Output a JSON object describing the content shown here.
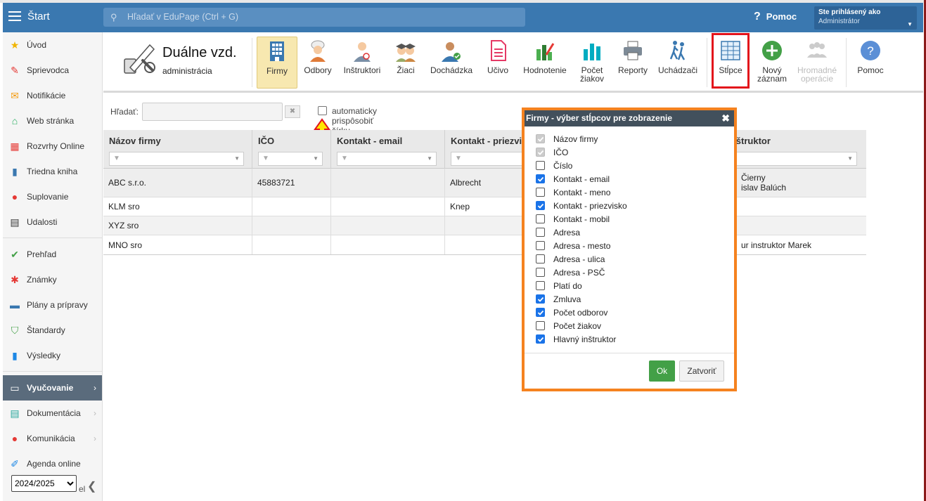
{
  "topbar": {
    "start_label": "Štart",
    "search_placeholder": "Hľadať v EduPage (Ctrl + G)",
    "help_label": "Pomoc",
    "user_line1": "Ste prihlásený ako",
    "user_line2": "Administrátor"
  },
  "sidebar": {
    "items": [
      {
        "label": "Úvod",
        "icon": "star-icon",
        "color": "#f0b400"
      },
      {
        "label": "Sprievodca",
        "icon": "wand-icon",
        "color": "#e53935"
      },
      {
        "label": "Notifikácie",
        "icon": "envelope-icon",
        "color": "#f39c12"
      },
      {
        "label": "Web stránka",
        "icon": "home-icon",
        "color": "#27ae60"
      },
      {
        "label": "Rozvrhy Online",
        "icon": "grid-icon",
        "color": "#e53935"
      },
      {
        "label": "Triedna kniha",
        "icon": "book-icon",
        "color": "#3a78b0"
      },
      {
        "label": "Suplovanie",
        "icon": "person-icon",
        "color": "#e53935"
      },
      {
        "label": "Udalosti",
        "icon": "calendar-icon",
        "color": "#333333"
      },
      {
        "label": "Prehľad",
        "icon": "check-circle-icon",
        "color": "#43a047"
      },
      {
        "label": "Známky",
        "icon": "grades-icon",
        "color": "#e53935"
      },
      {
        "label": "Plány a prípravy",
        "icon": "briefcase-icon",
        "color": "#3a78b0"
      },
      {
        "label": "Štandardy",
        "icon": "shield-icon",
        "color": "#43a047"
      },
      {
        "label": "Výsledky",
        "icon": "bar-chart-icon",
        "color": "#1e88e5"
      },
      {
        "label": "Vyučovanie",
        "icon": "open-book-icon",
        "color": "#ffffff"
      },
      {
        "label": "Dokumentácia",
        "icon": "document-icon",
        "color": "#26a69a"
      },
      {
        "label": "Komunikácia",
        "icon": "chat-icon",
        "color": "#e53935"
      },
      {
        "label": "Agenda online",
        "icon": "pen-icon",
        "color": "#1e88e5"
      }
    ],
    "year_options": [
      "2024/2025"
    ],
    "year_selected": "2024/2025",
    "ghost_label": "el"
  },
  "toolbar": {
    "app_title": "Duálne vzd.",
    "app_subtitle": "administrácia",
    "buttons": [
      {
        "label": "Firmy"
      },
      {
        "label": "Odbory"
      },
      {
        "label": "Inštruktori"
      },
      {
        "label": "Žiaci"
      },
      {
        "label": "Dochádzka"
      },
      {
        "label": "Učivo"
      },
      {
        "label": "Hodnotenie"
      },
      {
        "label1": "Počet",
        "label2": "žiakov"
      },
      {
        "label": "Reporty"
      },
      {
        "label": "Uchádzači"
      },
      {
        "label": "Stĺpce"
      },
      {
        "label1": "Nový",
        "label2": "záznam"
      },
      {
        "label1": "Hromadné",
        "label2": "operácie"
      },
      {
        "label": "Pomoc"
      }
    ]
  },
  "filter": {
    "search_label": "Hľadať:",
    "search_value": "",
    "auto_width_label": "automaticky prispôsobiť šírku stĺpcov"
  },
  "table": {
    "columns": [
      "Názov firmy",
      "IČO",
      "Kontakt - email",
      "Kontakt - priezvisko",
      "Hlavný inštruktor"
    ],
    "rows": [
      {
        "name": "ABC s.r.o.",
        "ico": "45883721",
        "email": "",
        "surname": "Albrecht",
        "instructor1": "Čierny",
        "instructor2": "islav Balúch"
      },
      {
        "name": "KLM sro",
        "ico": "",
        "email": "",
        "surname": "Knep",
        "instructor1": "",
        "instructor2": ""
      },
      {
        "name": "XYZ sro",
        "ico": "",
        "email": "",
        "surname": "",
        "instructor1": "",
        "instructor2": ""
      },
      {
        "name": "MNO sro",
        "ico": "",
        "email": "",
        "surname": "",
        "instructor1": "ur instruktor Marek",
        "instructor2": ""
      }
    ]
  },
  "modal": {
    "title": "Firmy - výber stĺpcov pre zobrazenie",
    "options": [
      {
        "label": "Názov firmy",
        "state": "disabled"
      },
      {
        "label": "IČO",
        "state": "disabled"
      },
      {
        "label": "Číslo",
        "state": "off"
      },
      {
        "label": "Kontakt - email",
        "state": "on"
      },
      {
        "label": "Kontakt - meno",
        "state": "off"
      },
      {
        "label": "Kontakt - priezvisko",
        "state": "on"
      },
      {
        "label": "Kontakt - mobil",
        "state": "off"
      },
      {
        "label": "Adresa",
        "state": "off"
      },
      {
        "label": "Adresa - mesto",
        "state": "off"
      },
      {
        "label": "Adresa - ulica",
        "state": "off"
      },
      {
        "label": "Adresa - PSČ",
        "state": "off"
      },
      {
        "label": "Platí do",
        "state": "off"
      },
      {
        "label": "Zmluva",
        "state": "on"
      },
      {
        "label": "Počet odborov",
        "state": "on"
      },
      {
        "label": "Počet žiakov",
        "state": "off"
      },
      {
        "label": "Hlavný inštruktor",
        "state": "on"
      }
    ],
    "ok_label": "Ok",
    "close_label": "Zatvoriť"
  }
}
